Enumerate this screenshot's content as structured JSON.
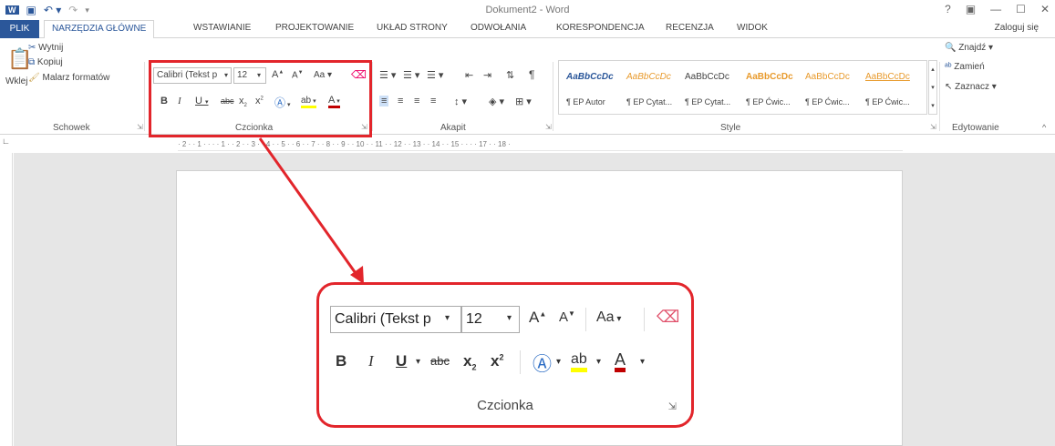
{
  "window": {
    "title": "Dokument2 - Word",
    "controls": [
      "?",
      "▣",
      "—",
      "☐",
      "✕"
    ],
    "login": "Zaloguj się"
  },
  "quick_access": {
    "icons": [
      "word-logo-icon",
      "save-icon",
      "undo-icon",
      "redo-icon",
      "customize-icon"
    ]
  },
  "tabs": [
    "PLIK",
    "NARZĘDZIA GŁÓWNE",
    "WSTAWIANIE",
    "PROJEKTOWANIE",
    "UKŁAD STRONY",
    "ODWOŁANIA",
    "KORESPONDENCJA",
    "RECENZJA",
    "WIDOK"
  ],
  "ribbon": {
    "clipboard": {
      "label": "Schowek",
      "paste": "Wklej",
      "cut": "Wytnij",
      "copy": "Kopiuj",
      "format_painter": "Malarz formatów"
    },
    "font": {
      "label": "Czcionka",
      "font_name": "Calibri (Tekst p",
      "font_size": "12"
    },
    "paragraph": {
      "label": "Akapit"
    },
    "styles": {
      "label": "Style",
      "items": [
        {
          "preview": "AaBbCcDc",
          "name": "¶ EP Autor"
        },
        {
          "preview": "AaBbCcDc",
          "name": "¶ EP Cytat..."
        },
        {
          "preview": "AaBbCcDc",
          "name": "¶ EP Cytat..."
        },
        {
          "preview": "AaBbCcDc",
          "name": "¶ EP Ćwic..."
        },
        {
          "preview": "AaBbCcDc",
          "name": "¶ EP Ćwic..."
        },
        {
          "preview": "AaBbCcDc",
          "name": "¶ EP Ćwic..."
        }
      ]
    },
    "editing": {
      "label": "Edytowanie",
      "find": "Znajdź",
      "replace": "Zamień",
      "select": "Zaznacz"
    }
  },
  "ruler": "· 2 · · 1 · · · · 1 · · 2 · · 3 · · 4 · · 5 · · 6 · · 7 · · 8 · · 9 · · 10 · · 11 · · 12 · · 13 · · 14 · · 15 · · · · 17 · · 18 ·",
  "zoom": {
    "font_name": "Calibri (Tekst p",
    "font_size": "12",
    "change_case": "Aa",
    "label": "Czcionka"
  },
  "colors": {
    "accent": "#2b579a",
    "highlight": "#e2252b",
    "text_highlight_yellow": "#ffff00",
    "font_color_red": "#c00000"
  }
}
